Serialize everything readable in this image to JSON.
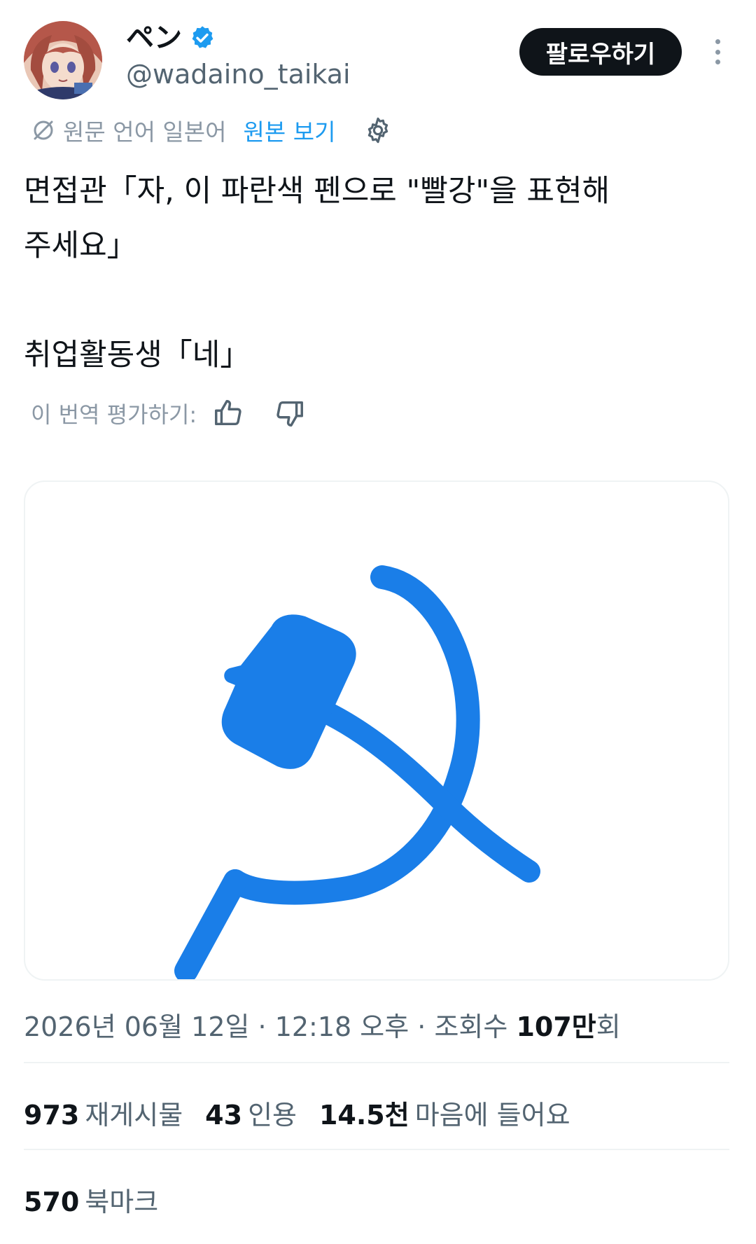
{
  "author": {
    "display_name": "ペン",
    "handle": "@wadaino_taikai",
    "verified": true
  },
  "actions": {
    "follow_label": "팔로우하기"
  },
  "translation": {
    "label": "원문 언어 일본어",
    "show_original": "원본 보기",
    "rate_label": "이 번역 평가하기:"
  },
  "tweet": {
    "line1": "면접관「자, 이 파란색 펜으로 \"빨강\"을 표현해",
    "line2": "주세요」",
    "line3": "",
    "line4": "취업활동생「네」"
  },
  "meta": {
    "date": "2026년 06월 12일",
    "separator1": " · ",
    "time": "12:18 오후",
    "separator2": " · ",
    "views_label": "조회수 ",
    "views_count": "107만",
    "views_suffix": "회"
  },
  "stats": {
    "reposts_count": "973",
    "reposts_label": "재게시물",
    "quotes_count": "43",
    "quotes_label": "인용",
    "likes_count": "14.5천",
    "likes_label": "마음에 들어요",
    "bookmarks_count": "570",
    "bookmarks_label": "북마크"
  },
  "colors": {
    "accent": "#1d9bf0",
    "drawing_blue": "#1a7ee8",
    "text_primary": "#0f1419",
    "text_secondary": "#536471"
  },
  "icons": {
    "verified": "verified-badge-icon",
    "translate": "translate-slash-icon",
    "settings": "gear-icon",
    "thumbs_up": "thumbs-up-icon",
    "thumbs_down": "thumbs-down-icon",
    "more": "more-vertical-icon"
  }
}
